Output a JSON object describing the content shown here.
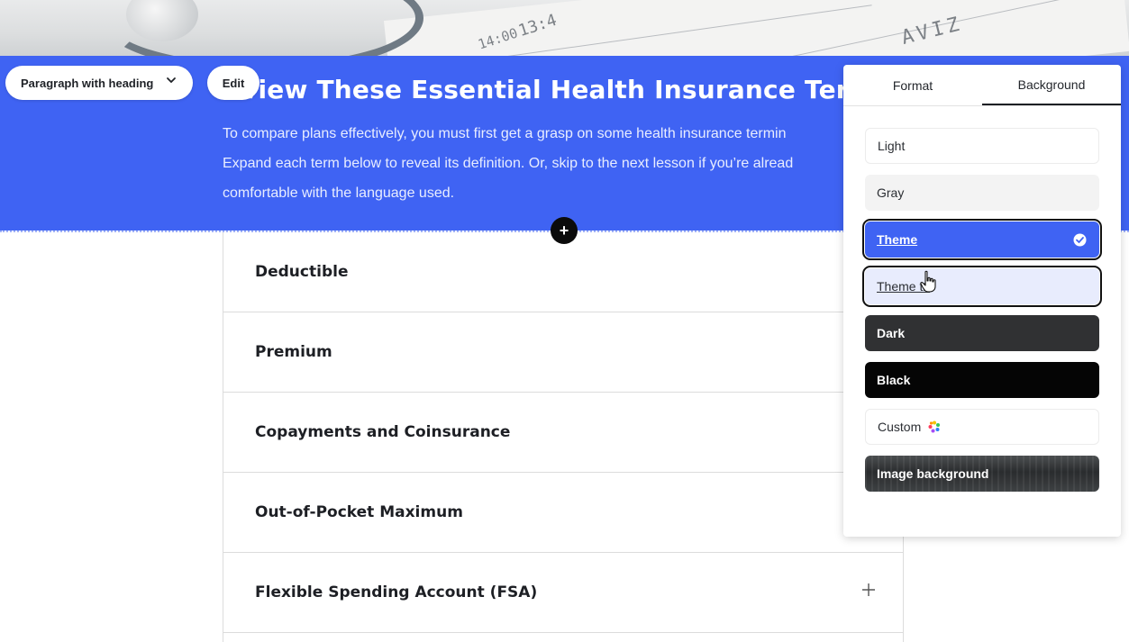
{
  "toolbar": {
    "block_style_label": "Paragraph with heading",
    "edit_label": "Edit"
  },
  "hero": {
    "heading": "view These Essential Health Insurance Terr",
    "paragraph_lines": [
      "To compare plans effectively, you must first get a grasp on some health insurance termin",
      "Expand each term below to reveal its definition. Or, skip to the next lesson if you’re alread",
      "comfortable with the language used."
    ],
    "background_color": "#3f63f3",
    "photo_text": [
      "13:4",
      "14:00",
      "AVIZ"
    ]
  },
  "accordion": {
    "items": [
      {
        "label": "Deductible"
      },
      {
        "label": "Premium"
      },
      {
        "label": "Copayments and Coinsurance"
      },
      {
        "label": "Out-of-Pocket Maximum"
      },
      {
        "label": "Flexible Spending Account (FSA)"
      }
    ]
  },
  "panel": {
    "tabs": [
      {
        "label": "Format",
        "active": false
      },
      {
        "label": "Background",
        "active": true
      }
    ],
    "options": [
      {
        "label": "Light",
        "selected": false
      },
      {
        "label": "Gray",
        "selected": false
      },
      {
        "label": "Theme",
        "selected": true
      },
      {
        "label": "Theme t2",
        "selected": false
      },
      {
        "label": "Dark",
        "selected": false
      },
      {
        "label": "Black",
        "selected": false
      },
      {
        "label": "Custom",
        "selected": false
      },
      {
        "label": "Image background",
        "selected": false
      }
    ]
  },
  "colors": {
    "theme": "#3f63f3",
    "theme_light": "#e8ecfd",
    "dark": "#303133",
    "black": "#050505"
  }
}
